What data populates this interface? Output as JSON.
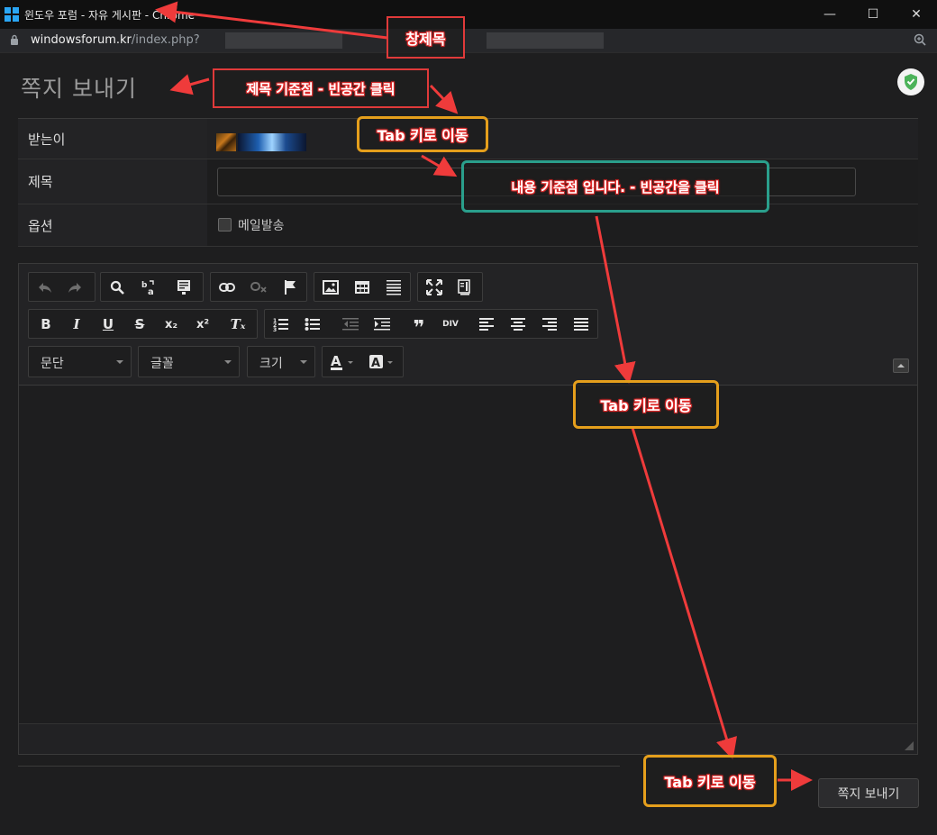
{
  "window": {
    "title": "윈도우 포럼 - 자유 게시판 - Chrome",
    "minimize_glyph": "—",
    "maximize_glyph": "☐",
    "close_glyph": "✕"
  },
  "address": {
    "host": "windowsforum.kr",
    "path": "/index.php?"
  },
  "page": {
    "title": "쪽지 보내기"
  },
  "form": {
    "recipient_label": "받는이",
    "subject_label": "제목",
    "subject_value": "",
    "options_label": "옵션",
    "email_checkbox_label": "메일발송",
    "email_checked": false
  },
  "editor": {
    "row1": [
      "undo-icon",
      "redo-icon",
      "find-icon",
      "replace-icon",
      "templates-icon",
      "link-icon",
      "unlink-icon",
      "anchor-icon",
      "image-icon",
      "table-icon",
      "horizontal-rule-icon",
      "maximize-icon",
      "source-icon"
    ],
    "row2": [
      "bold-icon",
      "italic-icon",
      "underline-icon",
      "strike-icon",
      "subscript-icon",
      "superscript-icon",
      "remove-format-icon",
      "numbered-list-icon",
      "bulleted-list-icon",
      "outdent-icon",
      "indent-icon",
      "blockquote-icon",
      "div-icon",
      "align-left-icon",
      "align-center-icon",
      "align-right-icon",
      "justify-icon"
    ],
    "glyphs": {
      "bold": "B",
      "italic": "I",
      "underline": "U",
      "strike": "S",
      "subscript": "x₂",
      "superscript": "x²",
      "remove_format": "Tₓ",
      "blockquote": "❞",
      "div": "DIV"
    },
    "combos": {
      "format": "문단",
      "font": "글꼴",
      "size": "크기"
    }
  },
  "buttons": {
    "send": "쪽지 보내기"
  },
  "annotations": {
    "window_title": "창제목",
    "subject_anchor": "제목 기준점 - 빈공간 클릭",
    "tab1": "Tab 키로 이동",
    "content_anchor": "내용 기준점 입니다. - 빈공간을 클릭",
    "tab2": "Tab 키로 이동",
    "tab3": "Tab 키로 이동"
  },
  "colors": {
    "annotation_red": "#e03a3a",
    "annotation_orange": "#e59f1c",
    "annotation_teal": "#2a9f8c",
    "arrow_red": "#ef3b3b"
  }
}
